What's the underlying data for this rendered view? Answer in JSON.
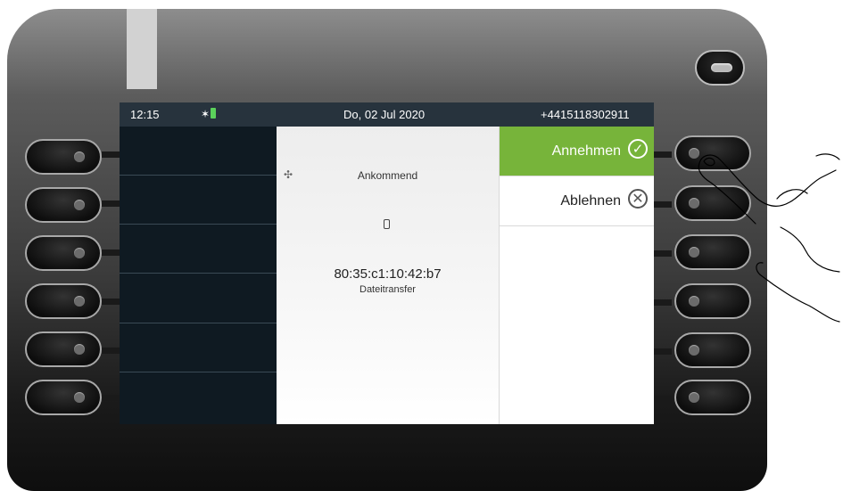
{
  "status_bar": {
    "time": "12:15",
    "date": "Do, 02 Jul 2020",
    "phone_number": "+4415118302911",
    "bluetooth_icon": "bluetooth-icon",
    "battery_color": "#5bd15b"
  },
  "call": {
    "incoming_label": "Ankommend",
    "device_icon": "mobile-phone-icon",
    "mac_address": "80:35:c1:10:42:b7",
    "transfer_label": "Dateitransfer"
  },
  "actions": {
    "accept_label": "Annehmen",
    "accept_icon": "checkmark-circle-icon",
    "reject_label": "Ablehnen",
    "reject_icon": "x-circle-icon",
    "accept_color": "#77b43a"
  },
  "colors": {
    "status_bar_bg": "#27333d",
    "screen_left_bg": "#0f1a22"
  }
}
